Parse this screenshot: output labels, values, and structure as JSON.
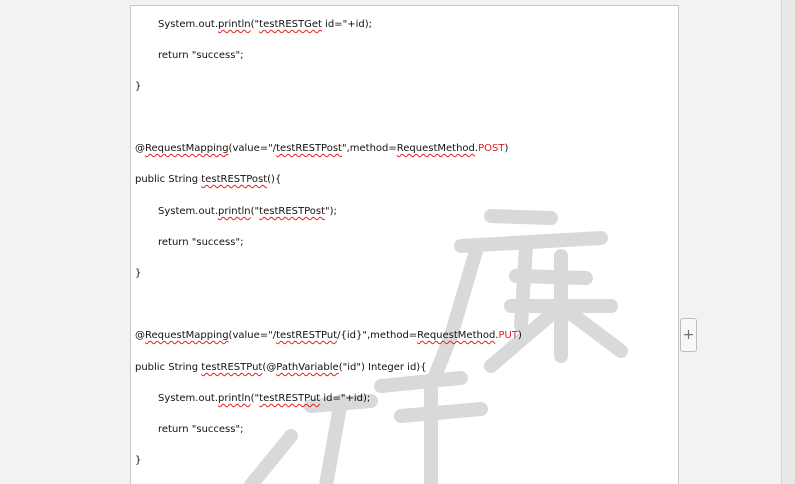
{
  "document": {
    "lines": {
      "l1": {
        "a": "System.out.",
        "b": "println",
        "c": "(\"",
        "d": "testRESTGet",
        "e": " id=\"+id);"
      },
      "l2": "return \"success\";",
      "l3": "}",
      "l4": {
        "a": "@",
        "b": "RequestMapping",
        "c": "(value=\"/",
        "d": "testRESTPost",
        "e": "\",method=",
        "f": "RequestMethod",
        "g": ".",
        "h": "POST",
        "i": ")"
      },
      "l5": {
        "a": "public String ",
        "b": "testRESTPost",
        "c": "(){"
      },
      "l6": {
        "a": "System.out.",
        "b": "println",
        "c": "(\"",
        "d": "testRESTPost",
        "e": "\");"
      },
      "l7": "return \"success\";",
      "l8": "}",
      "l9": {
        "a": "@",
        "b": "RequestMapping",
        "c": "(value=\"/",
        "d": "testRESTPut",
        "e": "/{id}\",method=",
        "f": "RequestMethod",
        "g": ".",
        "h": "PUT",
        "i": ")"
      },
      "l10": {
        "a": "public String ",
        "b": "testRESTPut",
        "c": "(@",
        "d": "PathVariable",
        "e": "(\"id\") Integer id){"
      },
      "l11": {
        "a": "System.out.",
        "b": "println",
        "c": "(\"",
        "d": "testRESTPut",
        "e": " id=\"+id);"
      },
      "l12": "return \"success\";",
      "l13": "}"
    }
  },
  "controls": {
    "add_label": "+"
  },
  "colors": {
    "squiggle": "#e02020",
    "watermark": "#d9d9d9",
    "keyword": "#e02020"
  },
  "icons": {
    "add": "plus-icon"
  }
}
